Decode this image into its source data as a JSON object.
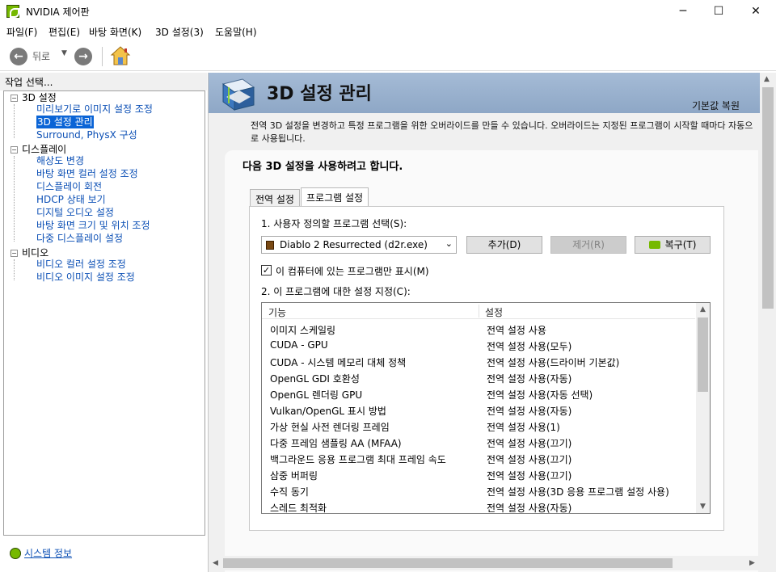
{
  "window": {
    "title": "NVIDIA 제어판",
    "minimize": "─",
    "maximize": "☐",
    "close": "✕"
  },
  "menu": [
    "파일(F)",
    "편집(E)",
    "바탕 화면(K)",
    "3D 설정(3)",
    "도움말(H)"
  ],
  "toolbar": {
    "back_label": "뒤로",
    "back_icon": "arrow-left-icon",
    "forward_icon": "arrow-right-icon",
    "home_icon": "home-icon"
  },
  "sidebar": {
    "header": "작업 선택...",
    "groups": [
      {
        "label": "3D 설정",
        "toggle": "−",
        "items": [
          "미리보기로 이미지 설정 조정",
          "3D 설정 관리",
          "Surround, PhysX 구성"
        ],
        "selected": 1
      },
      {
        "label": "디스플레이",
        "toggle": "−",
        "items": [
          "해상도 변경",
          "바탕 화면 컬러 설정 조정",
          "디스플레이 회전",
          "HDCP 상태 보기",
          "디지털 오디오 설정",
          "바탕 화면 크기 및 위치 조정",
          "다중 디스플레이 설정"
        ]
      },
      {
        "label": "비디오",
        "toggle": "−",
        "items": [
          "비디오 컬러 설정 조정",
          "비디오 이미지 설정 조정"
        ]
      }
    ],
    "system_info": "시스템 정보"
  },
  "main": {
    "title": "3D 설정 관리",
    "restore_defaults": "기본값 복원",
    "description": "전역 3D 설정을 변경하고 특정 프로그램을 위한 오버라이드를 만들 수 있습니다. 오버라이드는 지정된 프로그램이 시작할 때마다 자동으로 사용됩니다.",
    "panel_title": "다음 3D 설정을 사용하려고 합니다.",
    "tabs": [
      {
        "label": "전역 설정",
        "active": false
      },
      {
        "label": "프로그램 설정",
        "active": true
      }
    ],
    "step1_label": "1. 사용자 정의할 프로그램 선택(S):",
    "program_select": "Diablo 2 Resurrected (d2r.exe)",
    "add_button": "추가(D)",
    "remove_button": "제거(R)",
    "restore_button": "복구(T)",
    "show_only_label": "이 컴퓨터에 있는 프로그램만 표시(M)",
    "show_only_checked": true,
    "step2_label": "2. 이 프로그램에 대한 설정 지정(C):",
    "grid_headers": [
      "기능",
      "설정"
    ],
    "settings": [
      [
        "이미지 스케일링",
        "전역 설정 사용"
      ],
      [
        "CUDA - GPU",
        "전역 설정 사용(모두)"
      ],
      [
        "CUDA - 시스템 메모리 대체 정책",
        "전역 설정 사용(드라이버 기본값)"
      ],
      [
        "OpenGL GDI 호환성",
        "전역 설정 사용(자동)"
      ],
      [
        "OpenGL 렌더링 GPU",
        "전역 설정 사용(자동 선택)"
      ],
      [
        "Vulkan/OpenGL 표시 방법",
        "전역 설정 사용(자동)"
      ],
      [
        "가상 현실 사전 렌더링 프레임",
        "전역 설정 사용(1)"
      ],
      [
        "다중 프레임 샘플링 AA (MFAA)",
        "전역 설정 사용(끄기)"
      ],
      [
        "백그라운드 응용 프로그램 최대 프레임 속도",
        "전역 설정 사용(끄기)"
      ],
      [
        "삼중 버퍼링",
        "전역 설정 사용(끄기)"
      ],
      [
        "수직 동기",
        "전역 설정 사용(3D 응용 프로그램 설정 사용)"
      ],
      [
        "스레드 최적화",
        "전역 설정 사용(자동)"
      ]
    ]
  },
  "colors": {
    "nvidia_green": "#76b900",
    "selection": "#0a64d6",
    "link": "#0b4fb5",
    "banner": "#a5bbd6"
  }
}
